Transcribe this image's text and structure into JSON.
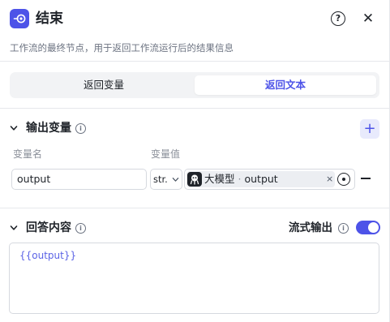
{
  "header": {
    "title": "结束",
    "node_icon": "end-node-icon",
    "help_icon": "help-icon",
    "close_icon": "close-icon",
    "help_glyph": "?",
    "close_glyph": "✕"
  },
  "description": "工作流的最终节点，用于返回工作流运行后的结果信息",
  "tabs": [
    {
      "label": "返回变量",
      "selected": false
    },
    {
      "label": "返回文本",
      "selected": true
    }
  ],
  "output_section": {
    "title": "输出变量",
    "add_glyph": "+",
    "columns": {
      "name": "变量名",
      "value": "变量值"
    },
    "rows": [
      {
        "name": "output",
        "type": "str.",
        "ref_source": "大模型",
        "ref_separator": "·",
        "ref_field": "output",
        "clear_glyph": "×"
      }
    ]
  },
  "answer_section": {
    "title": "回答内容",
    "stream_label": "流式输出",
    "stream_enabled": true,
    "content": "{{output}}"
  },
  "colors": {
    "accent": "#4d53e8",
    "text": "#1f2329",
    "muted": "#6b7280"
  },
  "info_glyph": "i"
}
